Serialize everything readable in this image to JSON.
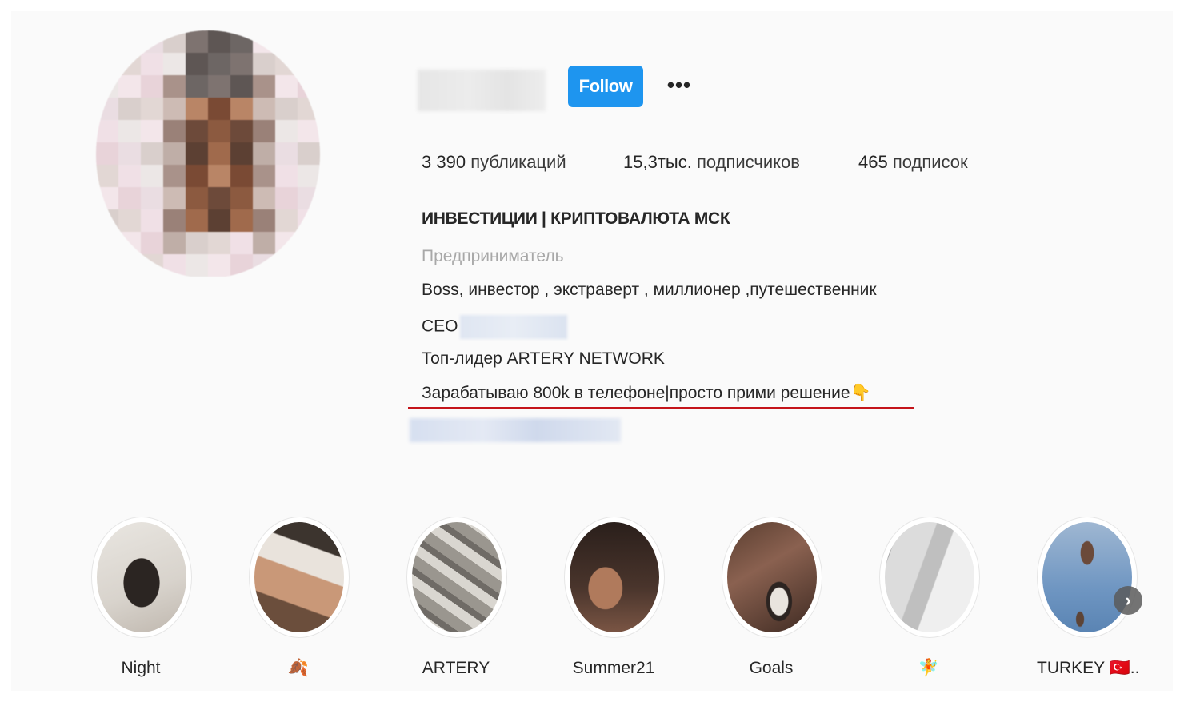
{
  "profile": {
    "follow_label": "Follow",
    "more_label": "•••",
    "stats": {
      "posts_num": "3 390",
      "posts_label": "публикаций",
      "followers_num": "15,3тыс.",
      "followers_label": "подписчиков",
      "following_num": "465",
      "following_label": "подписок"
    },
    "bio": {
      "name": "ИНВЕСТИЦИИ | КРИПТОВАЛЮТА МСК",
      "category": "Предприниматель",
      "line1": "Boss, инвестор , экстраверт , миллионер ,путешественник",
      "line2_prefix": "CEO",
      "line3": "Топ-лидер ARTERY NETWORK",
      "line4": "Зарабатываю 800k в телефоне|просто прими решение👇"
    }
  },
  "highlights": [
    {
      "label": "Night"
    },
    {
      "label": "🍂"
    },
    {
      "label": "ARTERY"
    },
    {
      "label": "Summer21"
    },
    {
      "label": "Goals"
    },
    {
      "label": "🧚"
    },
    {
      "label": "TURKEY 🇹🇷.."
    }
  ],
  "highlights_next_label": "›",
  "colors": {
    "follow_button": "#1e95ef",
    "underline": "#c4141a"
  }
}
